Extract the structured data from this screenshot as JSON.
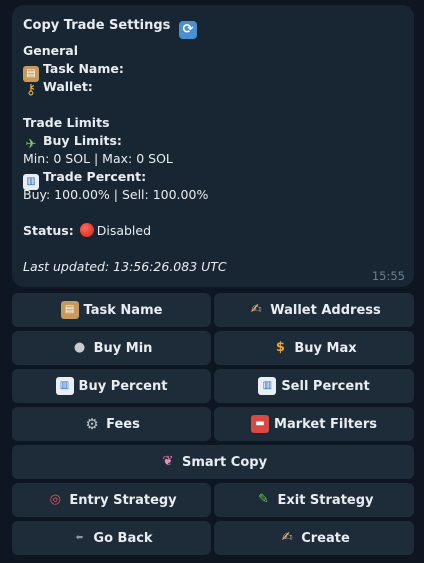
{
  "message": {
    "title": "Copy Trade Settings",
    "title_icon": "refresh-icon",
    "general_heading": "General",
    "task_name_label": "Task Name:",
    "wallet_label": "Wallet:",
    "trade_limits_heading": "Trade Limits",
    "buy_limits_label": "Buy Limits:",
    "buy_limits_value": "Min: 0 SOL | Max: 0 SOL",
    "trade_percent_label": "Trade Percent:",
    "trade_percent_value": "Buy: 100.00% | Sell: 100.00%",
    "status_label": "Status:",
    "status_value": "Disabled",
    "status_color": "#e0261a",
    "last_updated": "Last updated: 13:56:26.083 UTC",
    "time": "15:55"
  },
  "keyboard": {
    "task_name": "Task Name",
    "wallet_address": "Wallet Address",
    "buy_min": "Buy Min",
    "buy_max": "Buy Max",
    "buy_percent": "Buy Percent",
    "sell_percent": "Sell Percent",
    "fees": "Fees",
    "market_filters": "Market Filters",
    "smart_copy": "Smart Copy",
    "entry_strategy": "Entry Strategy",
    "exit_strategy": "Exit Strategy",
    "go_back": "Go Back",
    "create": "Create"
  },
  "colors": {
    "background": "#0e1621",
    "bubble": "#182533",
    "button": "#1e2c3a",
    "timestamp": "#6d7f8f"
  }
}
